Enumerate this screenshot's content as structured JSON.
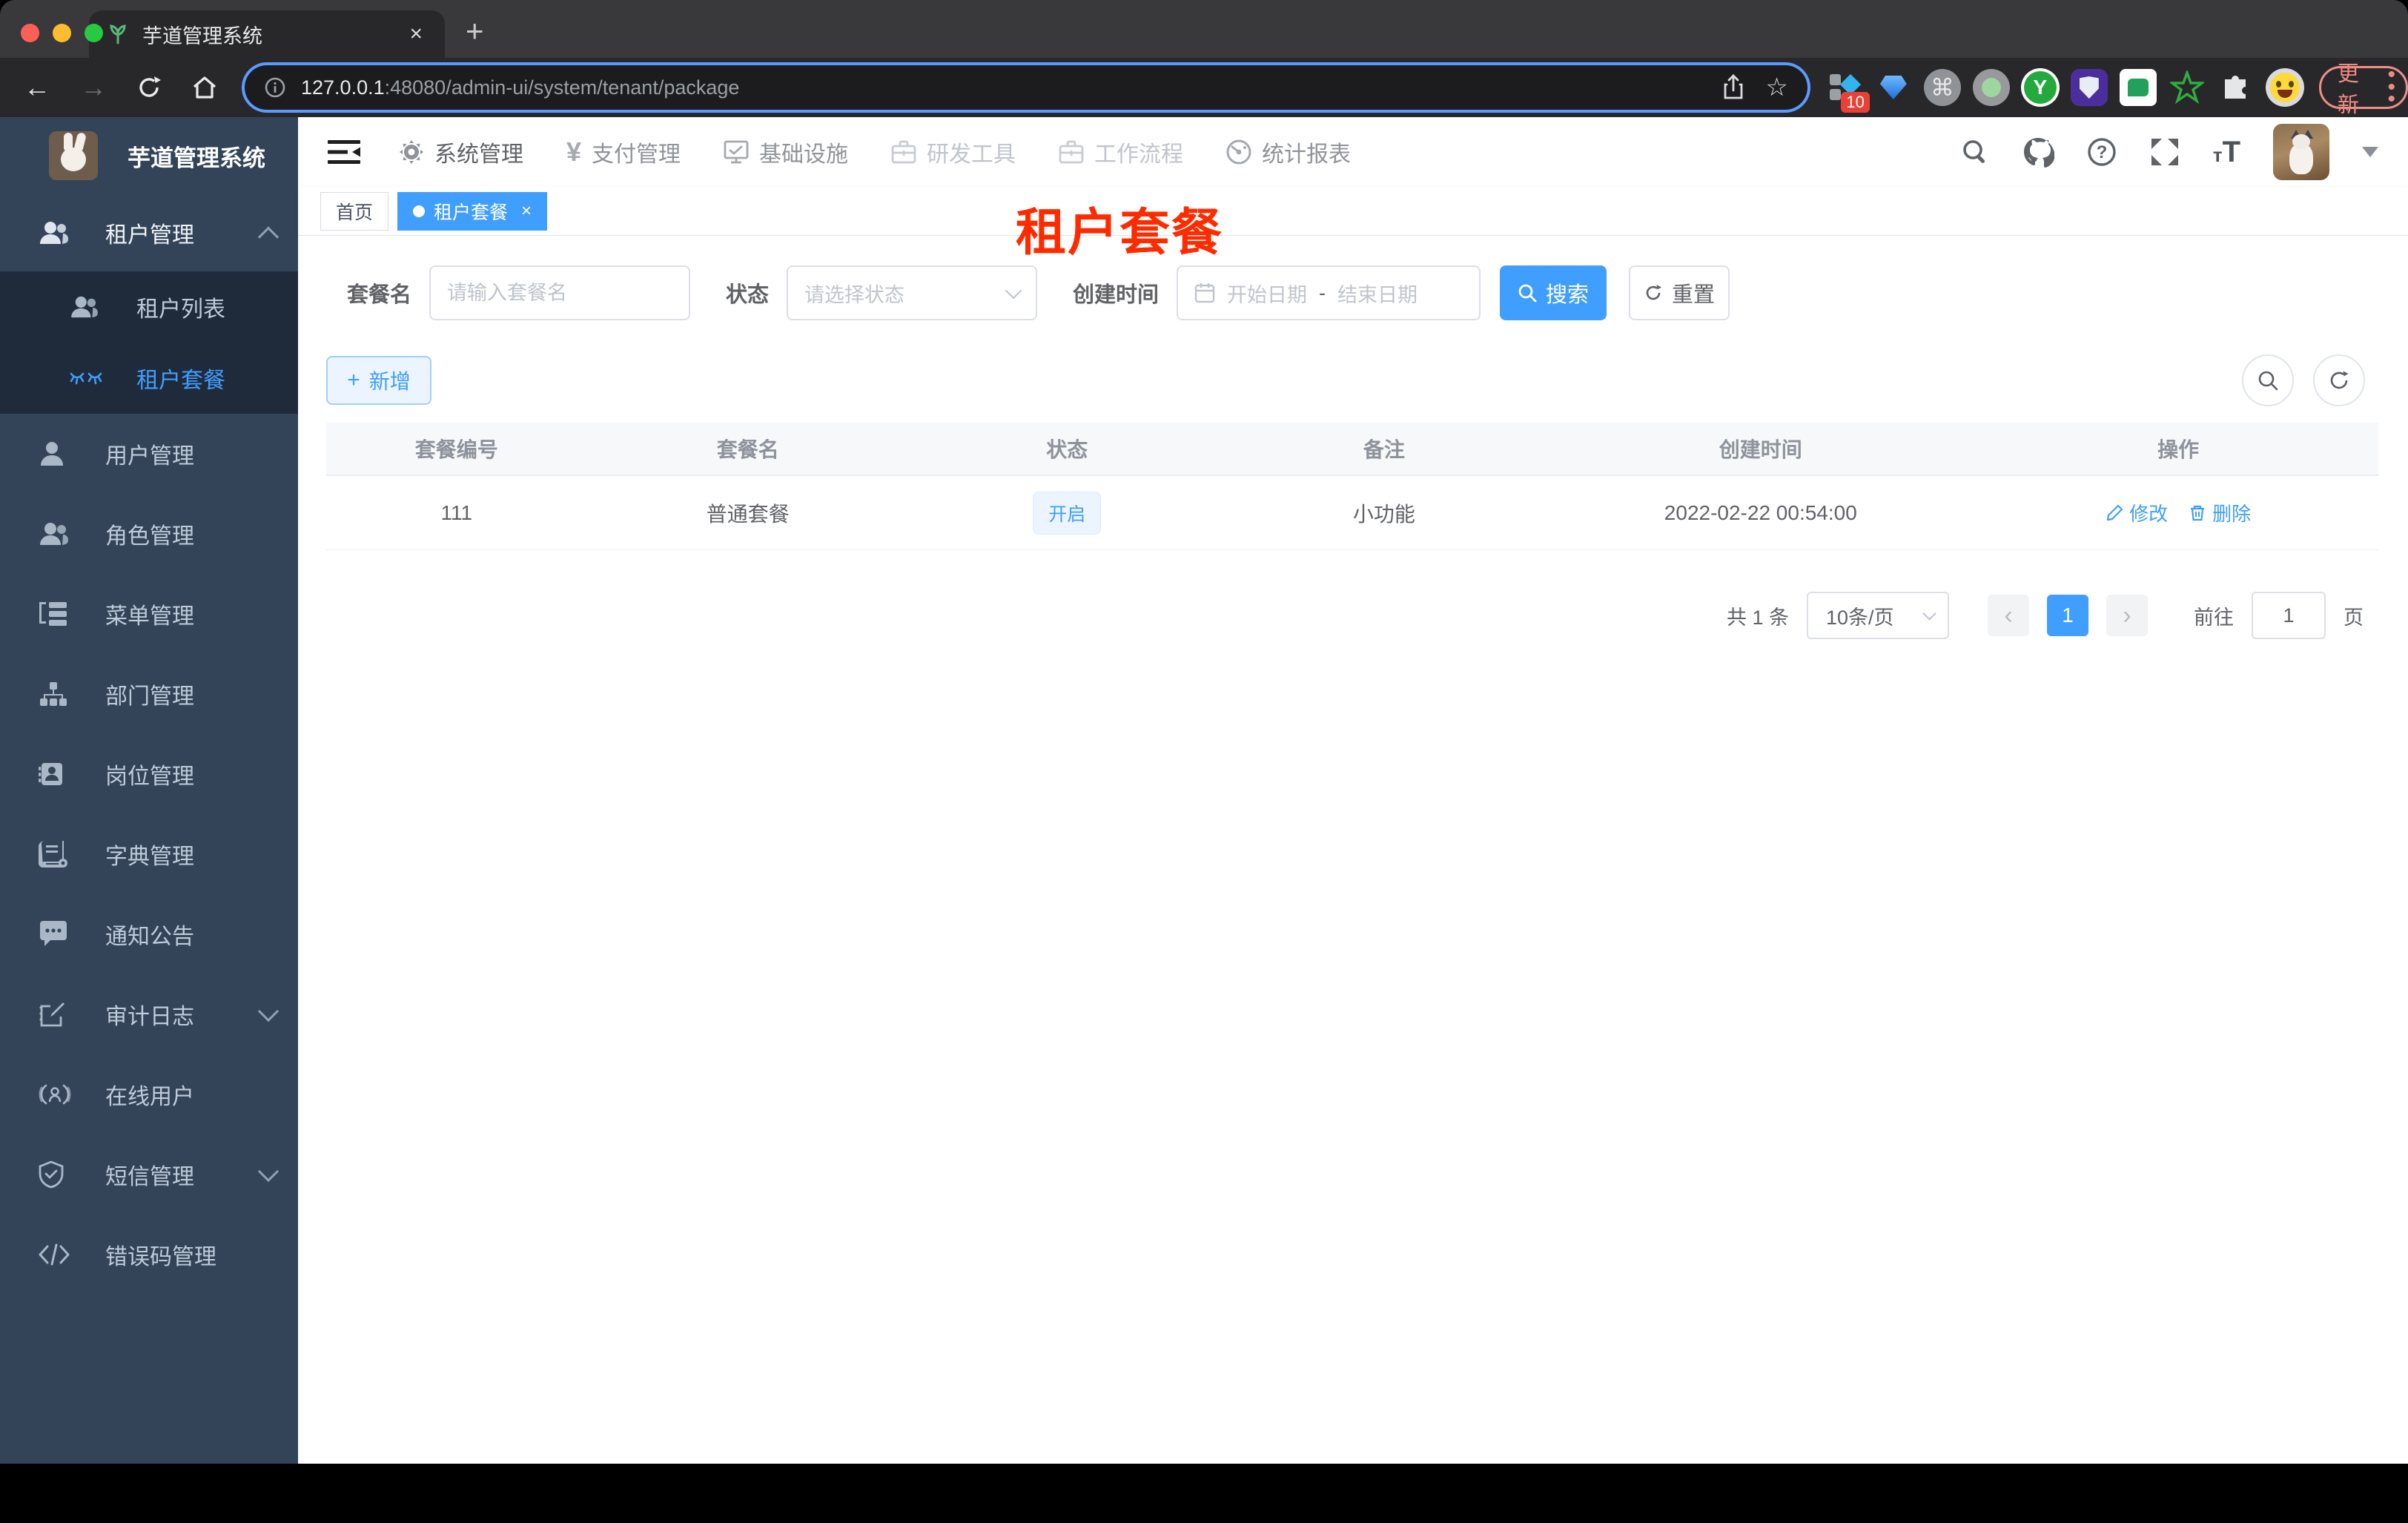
{
  "browser": {
    "tab_title": "芋道管理系统",
    "url_host": "127.0.0.1",
    "url_rest": ":48080/admin-ui/system/tenant/package",
    "extension_badge": "10",
    "update_label": "更新",
    "traffic_colors": {
      "close": "#ff5f57",
      "minimize": "#febc2e",
      "zoom": "#28c840"
    },
    "extension_icons": [
      "blocks-diamond-icon",
      "gem-icon",
      "command-icon",
      "record-circle-icon",
      "y-circle-icon",
      "shield-purple-icon",
      "chat-green-icon",
      "star-green-icon",
      "puzzle-icon",
      "emoji-face-icon"
    ]
  },
  "sidebar": {
    "app_title": "芋道管理系统",
    "items": [
      {
        "label": "租户管理",
        "icon": "users-icon",
        "state": "open"
      },
      {
        "label": "租户列表",
        "icon": "users-icon"
      },
      {
        "label": "租户套餐",
        "icon": "eyelash-icon",
        "active": true
      },
      {
        "label": "用户管理",
        "icon": "user-icon"
      },
      {
        "label": "角色管理",
        "icon": "users-icon"
      },
      {
        "label": "菜单管理",
        "icon": "tree-list-icon"
      },
      {
        "label": "部门管理",
        "icon": "org-chart-icon"
      },
      {
        "label": "岗位管理",
        "icon": "badge-icon"
      },
      {
        "label": "字典管理",
        "icon": "dictionary-icon"
      },
      {
        "label": "通知公告",
        "icon": "message-icon"
      },
      {
        "label": "审计日志",
        "icon": "edit-log-icon",
        "state": "collapsed"
      },
      {
        "label": "在线用户",
        "icon": "online-user-icon"
      },
      {
        "label": "短信管理",
        "icon": "shield-check-icon",
        "state": "collapsed"
      },
      {
        "label": "错误码管理",
        "icon": "code-icon"
      }
    ]
  },
  "topnav": {
    "items": [
      {
        "label": "系统管理",
        "icon": "gear-icon",
        "current": true
      },
      {
        "label": "支付管理",
        "icon": "yen-icon"
      },
      {
        "label": "基础设施",
        "icon": "monitor-icon"
      },
      {
        "label": "研发工具",
        "icon": "briefcase-icon",
        "dim": true
      },
      {
        "label": "工作流程",
        "icon": "briefcase-icon",
        "dim": true
      },
      {
        "label": "统计报表",
        "icon": "dashboard-icon"
      }
    ],
    "right_icons": [
      "search-icon",
      "github-icon",
      "help-icon",
      "fullscreen-icon",
      "font-size-icon",
      "avatar",
      "caret-down-icon"
    ],
    "font_size_glyph": "tT"
  },
  "tags": {
    "home": "首页",
    "active": "租户套餐"
  },
  "annotation": {
    "text": "租户套餐",
    "color": "#ff2b00"
  },
  "filters": {
    "name_label": "套餐名",
    "name_placeholder": "请输入套餐名",
    "status_label": "状态",
    "status_placeholder": "请选择状态",
    "date_label": "创建时间",
    "date_start": "开始日期",
    "date_separator": "-",
    "date_end": "结束日期",
    "search_label": "搜索",
    "reset_label": "重置"
  },
  "toolbar": {
    "add_label": "新增"
  },
  "table": {
    "headers": [
      "套餐编号",
      "套餐名",
      "状态",
      "备注",
      "创建时间",
      "操作"
    ],
    "rows": [
      {
        "id": "111",
        "name": "普通套餐",
        "status": "开启",
        "remark": "小功能",
        "created": "2022-02-22 00:54:00",
        "edit": "修改",
        "delete": "删除"
      }
    ]
  },
  "pagination": {
    "total": "共 1 条",
    "page_size": "10条/页",
    "page": "1",
    "goto_prefix": "前往",
    "goto_value": "1",
    "goto_suffix": "页"
  },
  "colors": {
    "accent": "#409EFF",
    "sidebar_bg": "#334459",
    "submenu_bg": "#1f2b3a",
    "annotation_red": "#ff2b00",
    "update_red": "#f08b82",
    "status_tag_bg": "#ecf5ff",
    "status_tag_border": "#d9ecff"
  }
}
